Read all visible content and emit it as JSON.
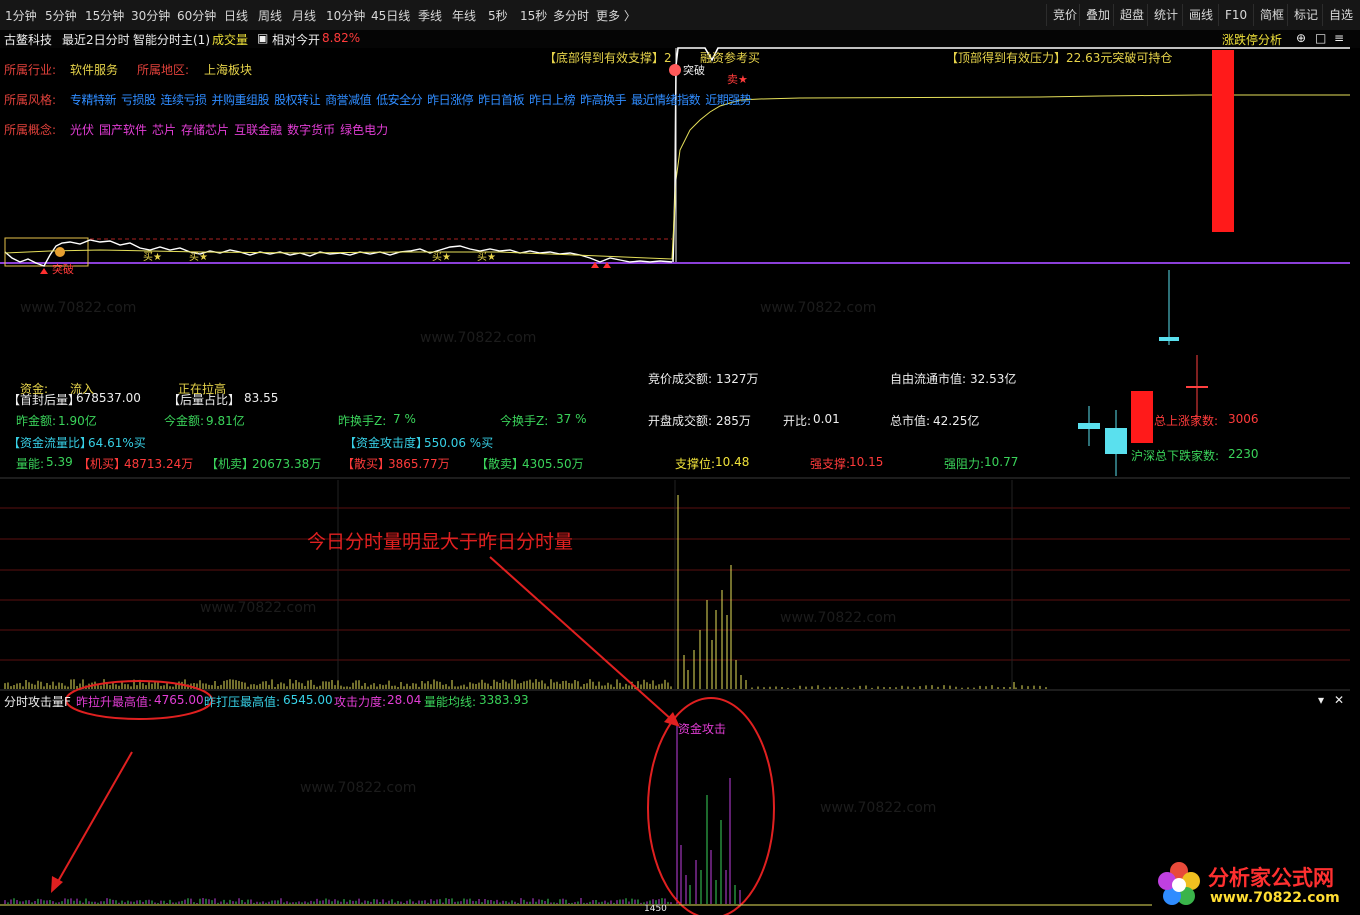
{
  "toolbar": {
    "periods": [
      "1分钟",
      "5分钟",
      "15分钟",
      "30分钟",
      "60分钟",
      "日线",
      "周线",
      "月线",
      "10分钟",
      "45日线",
      "季线",
      "年线",
      "5秒",
      "15秒",
      "多分时",
      "更多 〉"
    ],
    "right_buttons": [
      "竞价",
      "叠加",
      "超盘",
      "统计",
      "画线",
      "F10",
      "简框",
      "标记",
      "自选"
    ]
  },
  "infobar": {
    "stock_name": "古鳌科技",
    "mode": "最近2日分时",
    "indicator": "智能分时主(1)",
    "volume_label": "成交量",
    "relative_label": "相对今开",
    "relative_value": "8.82%",
    "right_title": "涨跌停分析",
    "icons": [
      "plus-circle-icon",
      "window-icon",
      "menu-icon",
      "close-icon"
    ]
  },
  "profile": {
    "industry_label": "所属行业:",
    "industry": "软件服务",
    "region_label": "所属地区:",
    "region": "上海板块",
    "style_label": "所属风格:",
    "styles": [
      "专精特新",
      "亏损股",
      "连续亏损",
      "并购重组股",
      "股权转让",
      "商誉减值",
      "低安全分",
      "昨日涨停",
      "昨日首板",
      "昨日上榜",
      "昨高换手",
      "最近情绪指数",
      "近期强势"
    ],
    "concept_label": "所属概念:",
    "concepts": [
      "光伏",
      "国产软件",
      "芯片",
      "存储芯片",
      "互联金融",
      "数字货币",
      "绿色电力"
    ]
  },
  "chart_labels": {
    "bottom_support": "【底部得到有效支撑】2",
    "buy_tag": "融资参考买",
    "top_pressure": "【顶部得到有效压力】22.63元突破可持仓",
    "break_tag": "突破",
    "sell_tag": "卖★",
    "buy_star": "买★",
    "break_tag2": "突破"
  },
  "stats": {
    "fund_label": "资金:",
    "fund_value": "流入",
    "pull_label": "正在拉高",
    "first_seal_label": "【首封后量】",
    "first_seal": "678537.00",
    "after_ratio_label": "【后量占比】",
    "after_ratio": "83.55",
    "yest_amount_label": "昨金额:",
    "yest_amount": "1.90亿",
    "today_amount_label": "今金额:",
    "today_amount": "9.81亿",
    "yest_turnover_label": "昨换手Z:",
    "yest_turnover": "7 %",
    "today_turnover_label": "今换手Z:",
    "today_turnover": "37 %",
    "flow_ratio_label": "【资金流量比】",
    "flow_ratio": "64.61%买",
    "attack_label": "【资金攻击度】",
    "attack": "550.06 %买",
    "vol_energy_label": "量能:",
    "vol_energy": "5.39",
    "inst_buy_label": "【机买】",
    "inst_buy": "48713.24万",
    "inst_sell_label": "【机卖】",
    "inst_sell": "20673.38万",
    "retail_buy_label": "【散买】",
    "retail_buy": "3865.77万",
    "retail_sell_label": "【散卖】",
    "retail_sell": "4305.50万",
    "bid_amount_label": "竞价成交额:",
    "bid_amount": "1327万",
    "open_amount_label": "开盘成交额:",
    "open_amount": "285万",
    "open_ratio_label": "开比:",
    "open_ratio": "0.01",
    "float_cap_label": "自由流通市值:",
    "float_cap": "32.53亿",
    "total_cap_label": "总市值:",
    "total_cap": "42.25亿",
    "support_label": "支撑位:",
    "support": "10.48",
    "strong_support_label": "强支撑:",
    "strong_support": "10.15",
    "strong_resist_label": "强阻力:",
    "strong_resist": "10.77",
    "up_count_label": "沪深总上涨家数:",
    "up_count": "3006",
    "up_count_visible_label": "总上涨家数:",
    "down_count_label": "沪深总下跌家数:",
    "down_count": "2230"
  },
  "annotation": {
    "note": "今日分时量明显大于昨日分时量"
  },
  "attack_panel": {
    "title": "分时攻击量F",
    "pull_high_label": "昨拉升最高值:",
    "pull_high": "4765.00",
    "press_high_label": "昨打压最高值:",
    "press_high": "6545.00",
    "force_label": "攻击力度:",
    "force": "28.04",
    "avg_label": "量能均线:",
    "avg": "3383.93",
    "tag": "资金攻击",
    "axis_partial": "1450"
  },
  "watermark": {
    "brand": "分析家公式网",
    "url": "www.70822.com"
  },
  "colors": {
    "price_line": "#ffffff",
    "avg_line": "#e6e05a",
    "base_line": "#8b3fd8",
    "grid": "#5a1010",
    "label_red": "#e0413b",
    "value_yellow": "#e6d34a",
    "style_blue": "#2f8cff",
    "concept_magenta": "#e23dd5",
    "attack_purple": "#c040e0",
    "attack_green": "#3ad35a",
    "annotation_red": "#e02020"
  }
}
